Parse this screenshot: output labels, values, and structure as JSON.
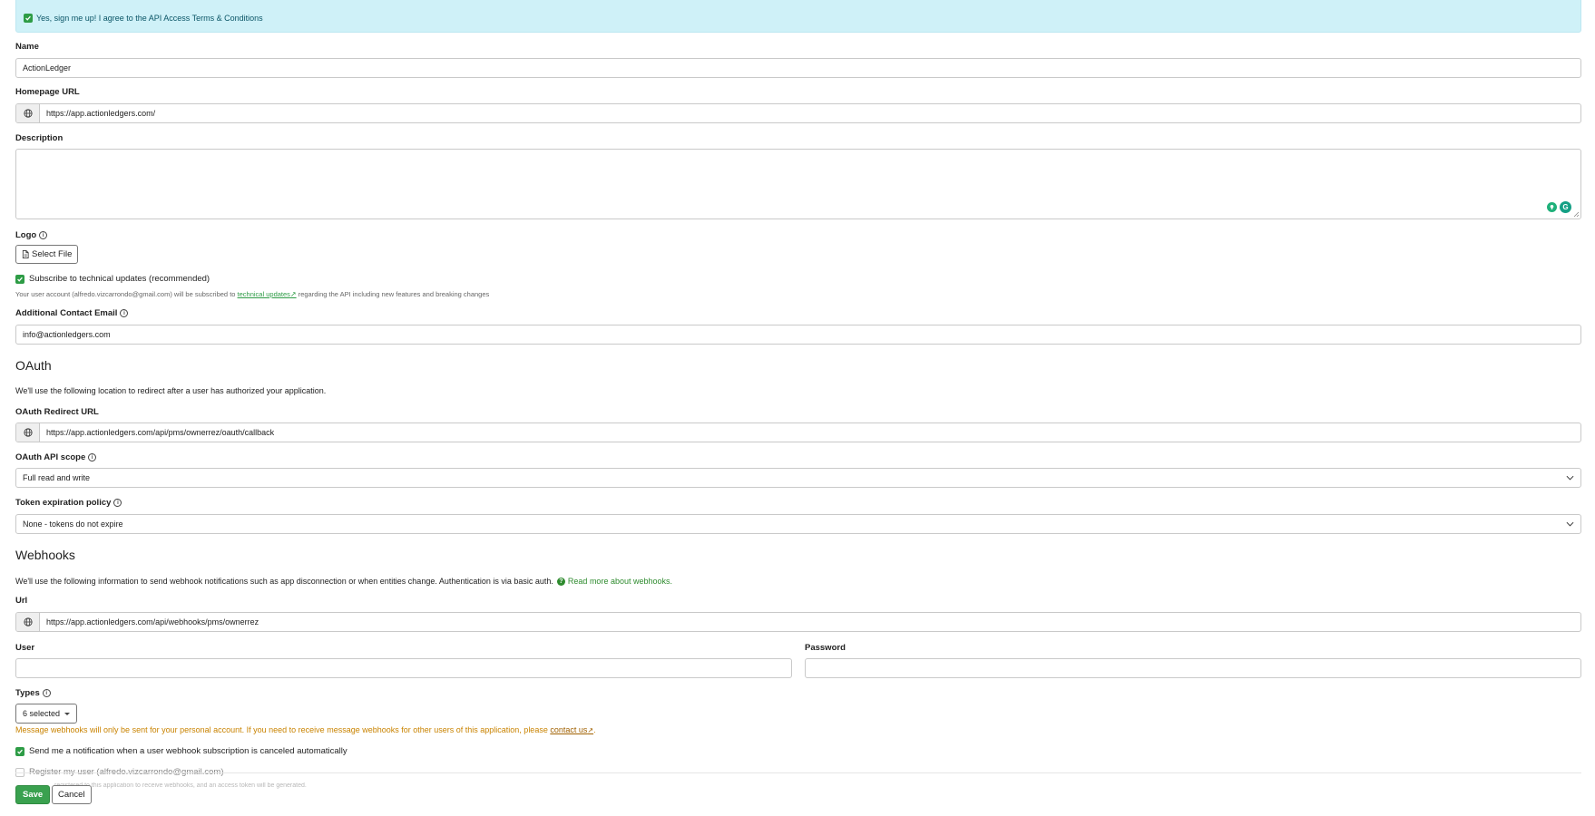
{
  "agreement": {
    "label": "Yes, sign me up! I agree to the API Access Terms & Conditions",
    "checked": true
  },
  "fields": {
    "name": {
      "label": "Name",
      "value": "ActionLedger"
    },
    "homepage_url": {
      "label": "Homepage URL",
      "value": "https://app.actionledgers.com/"
    },
    "description": {
      "label": "Description",
      "value": ""
    },
    "logo": {
      "label": "Logo",
      "button": "Select File"
    },
    "subscribe": {
      "label": "Subscribe to technical updates (recommended)",
      "checked": true,
      "hint_before": "Your user account (alfredo.vizcarrondo@gmail.com) will be subscribed to",
      "hint_link": "technical updates",
      "hint_after": "regarding the API including new features and breaking changes"
    },
    "contact_email": {
      "label": "Additional Contact Email",
      "value": "info@actionledgers.com"
    }
  },
  "oauth": {
    "title": "OAuth",
    "description": "We'll use the following location to redirect after a user has authorized your application.",
    "redirect_url": {
      "label": "OAuth Redirect URL",
      "value": "https://app.actionledgers.com/api/pms/ownerrez/oauth/callback"
    },
    "scope": {
      "label": "OAuth API scope",
      "value": "Full read and write"
    },
    "token_expiration": {
      "label": "Token expiration policy",
      "value": "None - tokens do not expire"
    }
  },
  "webhooks": {
    "title": "Webhooks",
    "description": "We'll use the following information to send webhook notifications such as app disconnection or when entities change. Authentication is via basic auth.",
    "read_more": "Read more about webhooks.",
    "url": {
      "label": "Url",
      "value": "https://app.actionledgers.com/api/webhooks/pms/ownerrez"
    },
    "user": {
      "label": "User",
      "value": ""
    },
    "password": {
      "label": "Password",
      "value": ""
    },
    "types": {
      "label": "Types",
      "value": "6 selected"
    },
    "warning_before": "Message webhooks will only be sent for your personal account. If you need to receive message webhooks for other users of this application, please",
    "warning_link": "contact us",
    "warning_after": ".",
    "notify_cancel": {
      "label": "Send me a notification when a user webhook subscription is canceled automatically",
      "checked": true
    },
    "register_user": {
      "label": "Register my user (alfredo.vizcarrondo@gmail.com)",
      "checked": false
    },
    "register_hint": "registered to this application to receive webhooks, and an access token will be generated."
  },
  "actions": {
    "save": "Save",
    "cancel": "Cancel"
  },
  "colors": {
    "accent": "#3aa14f",
    "banner": "#cff1f8",
    "warning": "#c98300"
  }
}
